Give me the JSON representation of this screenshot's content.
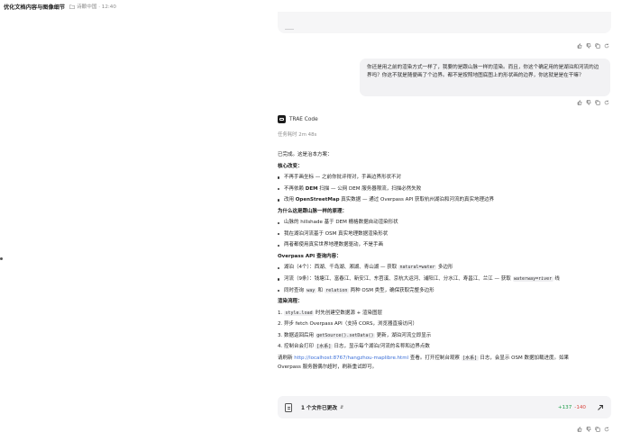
{
  "header": {
    "title": "优化文档内容与图像细节",
    "folder_icon": "folder-icon",
    "folder_label": "诗酿中国 · 12:40"
  },
  "user_message": {
    "text": "你还是用之前的渲染方式一样了，我要的是跟山脉一样的渲染。而且，你这个确定用的是湖泊和河流的边界吗？你这不就是随便画了个边界。都不是按照地图底图上的形状画的边界，你这就是是在干嘛？"
  },
  "agent": {
    "name": "TRAE Code",
    "elapsed": "任务耗时 2m 48s"
  },
  "response": {
    "intro": "已完成。这是治本方案：",
    "s1_title": "核心改变：",
    "s1_items": [
      {
        "pre": "不再手画坐标 — 之前你批评得对，手画边界形状不对",
        "bold": "",
        "post": ""
      },
      {
        "pre": "不再依赖 ",
        "bold": "DEM",
        "post": " 扫描 — 公网 DEM 服务器限流，扫描必然失败"
      },
      {
        "pre": "改用 ",
        "bold": "OpenStreetMap",
        "post": " 真实数据 — 通过 Overpass API 获取杭州湖泊和河流的真实地理边界"
      }
    ],
    "s2_title": "为什么这是跟山脉一样的原理：",
    "s2_items": [
      "山脉的 hillshade 基于 DEM 栅格数据自动渲染形状",
      "我在湖泊河流基于 OSM 真实地理数据渲染形状",
      "两者都使用真实世界地理数据驱动，不是手画"
    ],
    "s3_title": "Overpass API 查询内容：",
    "s3_items": [
      {
        "pre": "湖泊（4个）：西湖、千岛湖、湘湖、青山湖 — 获取 ",
        "code": "natural=water",
        "post": " 多边形"
      },
      {
        "pre": "河流（9条）：钱塘江、富春江、新安江、东苕溪、京杭大运河、浦阳江、分水江、寿昌江、兰江 — 获取 ",
        "code": "waterway=river",
        "post": " 线"
      },
      {
        "pre": "同时查询 ",
        "code": "way",
        "mid": " 和 ",
        "code2": "relation",
        "post": " 两种 OSM 类型，确保获取完整多边形"
      }
    ],
    "s4_title": "渲染流程：",
    "s4_items": [
      {
        "n": "1.",
        "code": "style.load",
        "post": " 时先创建空数据源 + 渲染图层"
      },
      {
        "n": "2.",
        "pre": "异步 fetch Overpass API（支持 CORS，浏览器直接访问）"
      },
      {
        "n": "3.",
        "pre": "数据返回后用 ",
        "code": "getSource().setData()",
        "post": " 更新，湖泊河流立即显示"
      },
      {
        "n": "4.",
        "pre": "控制台会打印 ",
        "code": "[水系]",
        "post": " 日志，显示每个湖泊/河流的名称和边界点数"
      }
    ],
    "outro1_pre": "请刷新 ",
    "outro1_link": "http://localhost:8767/hangzhou-maplibre.html",
    "outro1_mid": " 查看。打开控制台观察 ",
    "outro1_code": "[水系]",
    "outro1_post": " 日志，会显示 OSM 数据加载进度。如果",
    "outro2": "Overpass 服务器偶尔超时，刷新重试即可。"
  },
  "files_bar": {
    "label": "1 个文件已更改",
    "additions": "+137",
    "deletions": "-140"
  },
  "icons": {
    "like": "thumbs-up-icon",
    "dislike": "thumbs-down-icon",
    "copy": "copy-icon",
    "retry": "retry-icon"
  }
}
